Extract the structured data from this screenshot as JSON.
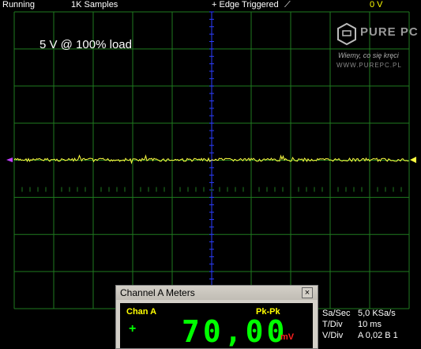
{
  "status": {
    "running": "Running",
    "samples": "1K Samples",
    "trigger": "+ Edge Triggered",
    "trigger_level": "0 V"
  },
  "overlay_title": "5 V @ 100% load",
  "watermark": {
    "brand": "PURE PC",
    "tagline": "Wiemy, co się kręci",
    "url": "WWW.PUREPC.PL"
  },
  "colors": {
    "grid": "#1f7a1f",
    "axis": "#2a3cff",
    "trace": "#ffff40",
    "trace_highlight": "#c040ff"
  },
  "meter": {
    "title": "Channel A Meters",
    "close": "×",
    "channel": "Chan A",
    "mode": "Pk-Pk",
    "sign": "+",
    "value": "70,00",
    "unit": "mV"
  },
  "info": [
    {
      "key": "Sa/Sec",
      "value": "5,0 KSa/s"
    },
    {
      "key": "T/Div",
      "value": "10 ms"
    },
    {
      "key": "V/Div",
      "value": "A 0,02   B 1"
    }
  ]
}
